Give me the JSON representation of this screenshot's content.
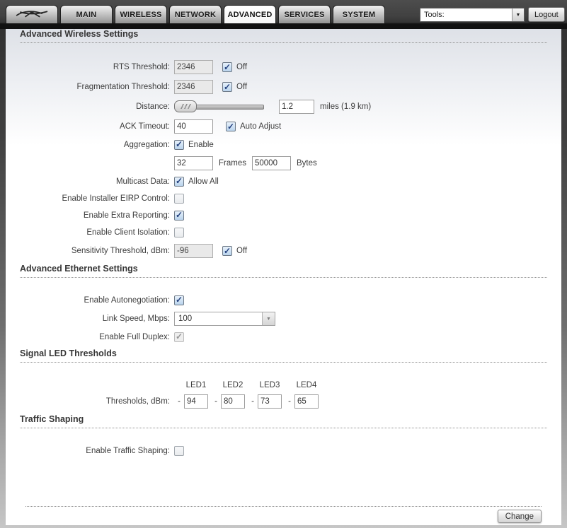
{
  "colors": {
    "check_accent": "#24417e",
    "tab_active_bg": "#ffffff",
    "frame_dark": "#2e2e2e",
    "content_top": "#dee1e7"
  },
  "header": {
    "tabs": [
      {
        "label": "MAIN"
      },
      {
        "label": "WIRELESS"
      },
      {
        "label": "NETWORK"
      },
      {
        "label": "ADVANCED"
      },
      {
        "label": "SERVICES"
      },
      {
        "label": "SYSTEM"
      }
    ],
    "active_tab": "ADVANCED",
    "tools_select": {
      "value": "Tools:",
      "arrow_icon": "▼"
    },
    "logout_label": "Logout"
  },
  "wireless": {
    "title": "Advanced Wireless Settings",
    "rts": {
      "label": "RTS Threshold:",
      "value": "2346",
      "disabled": true,
      "off_label": "Off",
      "off_checked": true
    },
    "frag": {
      "label": "Fragmentation Threshold:",
      "value": "2346",
      "disabled": true,
      "off_label": "Off",
      "off_checked": true
    },
    "distance": {
      "label": "Distance:",
      "value": "1.2",
      "unit_label": "miles (1.9 km)"
    },
    "ack": {
      "label": "ACK Timeout:",
      "value": "40",
      "auto_label": "Auto Adjust",
      "auto_checked": true
    },
    "aggregation": {
      "label": "Aggregation:",
      "enable_label": "Enable",
      "checked": true,
      "frames_value": "32",
      "frames_label": "Frames",
      "bytes_value": "50000",
      "bytes_label": "Bytes"
    },
    "multicast": {
      "label": "Multicast Data:",
      "allow_label": "Allow All",
      "checked": true
    },
    "eirp": {
      "label": "Enable Installer EIRP Control:",
      "checked": false
    },
    "extra_reporting": {
      "label": "Enable Extra Reporting:",
      "checked": true
    },
    "client_isolation": {
      "label": "Enable Client Isolation:",
      "checked": false
    },
    "sensitivity": {
      "label": "Sensitivity Threshold, dBm:",
      "value": "-96",
      "disabled": true,
      "off_label": "Off",
      "off_checked": true
    }
  },
  "ethernet": {
    "title": "Advanced Ethernet Settings",
    "autoneg": {
      "label": "Enable Autonegotiation:",
      "checked": true
    },
    "link_speed": {
      "label": "Link Speed, Mbps:",
      "value": "100",
      "arrow_icon": "▼"
    },
    "full_duplex": {
      "label": "Enable Full Duplex:",
      "checked": true,
      "disabled": true
    }
  },
  "led": {
    "title": "Signal LED Thresholds",
    "columns": [
      "LED1",
      "LED2",
      "LED3",
      "LED4"
    ],
    "row_label": "Thresholds, dBm:",
    "minus": "-",
    "values": [
      "94",
      "80",
      "73",
      "65"
    ]
  },
  "traffic": {
    "title": "Traffic Shaping",
    "enable": {
      "label": "Enable Traffic Shaping:",
      "checked": false
    }
  },
  "footer": {
    "change_label": "Change"
  }
}
